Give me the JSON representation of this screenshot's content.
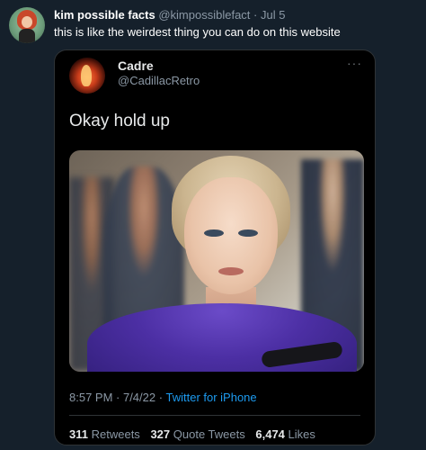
{
  "outer": {
    "name": "kim possible facts",
    "handle": "@kimpossiblefact",
    "separator": "·",
    "date": "Jul 5",
    "text": "this is like the weirdest thing you can do on this website"
  },
  "quote": {
    "name": "Cadre",
    "handle": "@CadillacRetro",
    "more": "···",
    "text": "Okay hold up",
    "time": "8:57 PM · 7/4/22",
    "separator": "·",
    "source": "Twitter for iPhone",
    "stats": {
      "retweets": "311",
      "retweets_label": "Retweets",
      "quote_tweets": "327",
      "quote_tweets_label": "Quote Tweets",
      "likes": "6,474",
      "likes_label": "Likes"
    }
  },
  "colors": {
    "background": "#15202b",
    "card": "#000000",
    "link": "#1d9bf0",
    "muted": "#8b98a5"
  },
  "icons": [
    "more-options-icon"
  ]
}
